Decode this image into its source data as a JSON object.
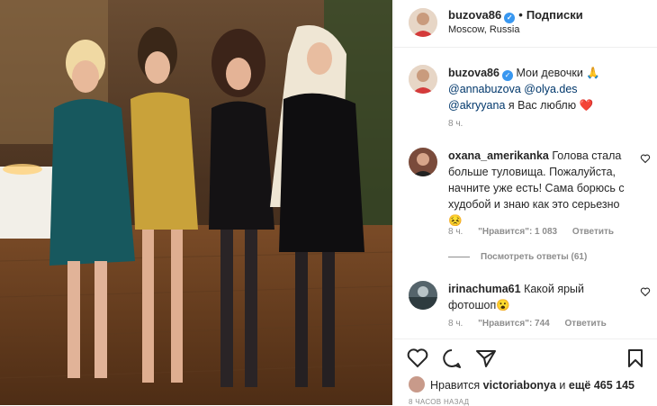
{
  "post": {
    "author": "buzova86",
    "follow_label": "Подписки",
    "dot": "•",
    "location": "Moscow, Russia"
  },
  "caption": {
    "author": "buzova86",
    "text_intro": "Мои девочки 🙏",
    "mentions": [
      "@annabuzova",
      "@olya.des",
      "@akryyana"
    ],
    "text_end": "я Вас люблю",
    "heart": "❤️",
    "time": "8 ч."
  },
  "comments": [
    {
      "author": "oxana_amerikanka",
      "text": "Голова стала больше туловища. Пожалуйста, начните уже есть! Сама борюсь с худобой и знаю как это серьезно 😣",
      "time": "8 ч.",
      "likes": "\"Нравится\": 1 083",
      "reply": "Ответить"
    },
    {
      "author": "irinachuma61",
      "text": "Какой ярый фотошоп😮",
      "time": "8 ч.",
      "likes": "\"Нравится\": 744",
      "reply": "Ответить"
    }
  ],
  "view_replies": "Посмотреть ответы (61)",
  "likes_line": {
    "prefix": "Нравится",
    "user": "victoriabonya",
    "middle": "и",
    "rest": "ещё 465 145"
  },
  "posted_time": "8 ЧАСОВ НАЗАД",
  "icons": {
    "verified": "verified-badge-icon",
    "like": "heart-icon",
    "comment": "comment-icon",
    "share": "share-icon",
    "save": "bookmark-icon"
  }
}
